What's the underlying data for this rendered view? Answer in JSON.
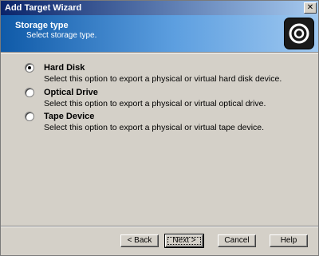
{
  "window": {
    "title": "Add Target Wizard"
  },
  "header": {
    "title": "Storage type",
    "subtitle": "Select storage type."
  },
  "options": [
    {
      "label": "Hard Disk",
      "description": "Select this option to export a physical or virtual hard disk device.",
      "selected": true
    },
    {
      "label": "Optical Drive",
      "description": "Select this option to export a physical or virtual optical drive.",
      "selected": false
    },
    {
      "label": "Tape Device",
      "description": "Select this option to export a physical or virtual tape device.",
      "selected": false
    }
  ],
  "buttons": {
    "back": "< Back",
    "next": "Next >",
    "cancel": "Cancel",
    "help": "Help"
  },
  "icons": {
    "close": "close-icon",
    "logo": "target-logo-icon"
  },
  "colors": {
    "title_bar": "#0a246a",
    "header_start": "#0f5aa8",
    "header_end": "#9fc8f0",
    "face": "#d4d0c8"
  }
}
